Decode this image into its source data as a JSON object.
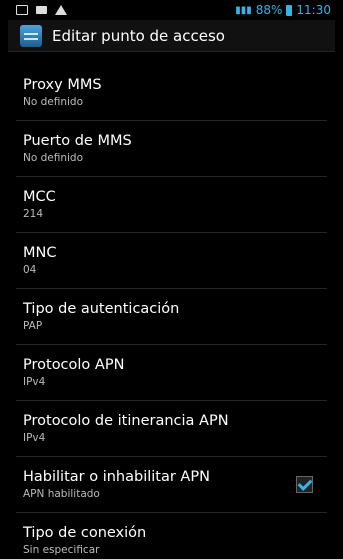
{
  "status_bar": {
    "battery": "88%",
    "time": "11:30"
  },
  "action_bar": {
    "title": "Editar punto de acceso"
  },
  "settings": [
    {
      "title": "Proxy MMS",
      "summary": "No definido"
    },
    {
      "title": "Puerto de MMS",
      "summary": "No definido"
    },
    {
      "title": "MCC",
      "summary": "214"
    },
    {
      "title": "MNC",
      "summary": "04"
    },
    {
      "title": "Tipo de autenticación",
      "summary": "PAP"
    },
    {
      "title": "Protocolo APN",
      "summary": "IPv4"
    },
    {
      "title": "Protocolo de itinerancia APN",
      "summary": "IPv4"
    },
    {
      "title": "Habilitar o inhabilitar APN",
      "summary": "APN habilitado",
      "checked": true
    },
    {
      "title": "Tipo de conexión",
      "summary": "Sin especificar"
    }
  ],
  "colors": {
    "accent": "#33b5e5",
    "background": "#000000"
  }
}
